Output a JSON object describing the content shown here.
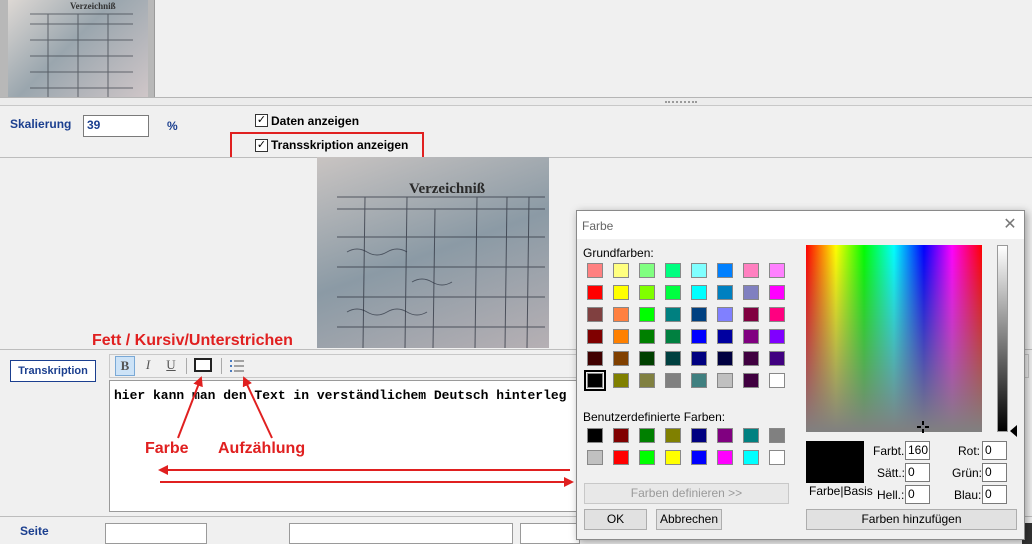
{
  "scaling": {
    "label": "Skalierung",
    "value": "39",
    "unit": "%"
  },
  "checkboxes": [
    {
      "label": "Daten anzeigen",
      "checked": true
    },
    {
      "label": "Transskription anzeigen",
      "checked": true
    }
  ],
  "thumb": {
    "caption": "Verzeichniß"
  },
  "document": {
    "heading": "Verzeichniß"
  },
  "annotations": {
    "style": "Fett / Kursiv/Unterstrichen",
    "color": "Farbe",
    "list": "Aufzählung"
  },
  "transcription": {
    "tab_label": "Transkription",
    "toolbar": {
      "bold": "B",
      "italic": "I",
      "underline": "U"
    },
    "editor_text": "hier kann man den Text in verständlichem Deutsch hinterleg"
  },
  "bottom": {
    "page_label": "Seite"
  },
  "color_dialog": {
    "title": "Farbe",
    "basic_label": "Grundfarben:",
    "basic_colors": [
      "#ff8080",
      "#ffff80",
      "#80ff80",
      "#00ff80",
      "#80ffff",
      "#0080ff",
      "#ff80c0",
      "#ff80ff",
      "#ff0000",
      "#ffff00",
      "#80ff00",
      "#00ff40",
      "#00ffff",
      "#0080c0",
      "#8080c0",
      "#ff00ff",
      "#804040",
      "#ff8040",
      "#00ff00",
      "#008080",
      "#004080",
      "#8080ff",
      "#800040",
      "#ff0080",
      "#800000",
      "#ff8000",
      "#008000",
      "#008040",
      "#0000ff",
      "#0000a0",
      "#800080",
      "#8000ff",
      "#400000",
      "#804000",
      "#004000",
      "#004040",
      "#000080",
      "#000040",
      "#400040",
      "#400080",
      "#000000",
      "#808000",
      "#808040",
      "#808080",
      "#408080",
      "#c0c0c0",
      "#400040",
      "#ffffff"
    ],
    "custom_label": "Benutzerdefinierte Farben:",
    "custom_colors": [
      "#000000",
      "#800000",
      "#008000",
      "#808000",
      "#000080",
      "#800080",
      "#008080",
      "#808080",
      "#c0c0c0",
      "#ff0000",
      "#00ff00",
      "#ffff00",
      "#0000ff",
      "#ff00ff",
      "#00ffff",
      "#ffffff"
    ],
    "define_button": "Farben definieren >>",
    "ok_button": "OK",
    "cancel_button": "Abbrechen",
    "preview_label": "Farbe|Basis",
    "hue": {
      "label": "Farbt.:",
      "value": "160"
    },
    "sat": {
      "label": "Sätt.:",
      "value": "0"
    },
    "lum": {
      "label": "Hell.:",
      "value": "0"
    },
    "red": {
      "label": "Rot:",
      "value": "0"
    },
    "green": {
      "label": "Grün:",
      "value": "0"
    },
    "blue": {
      "label": "Blau:",
      "value": "0"
    },
    "add_button": "Farben hinzufügen"
  }
}
